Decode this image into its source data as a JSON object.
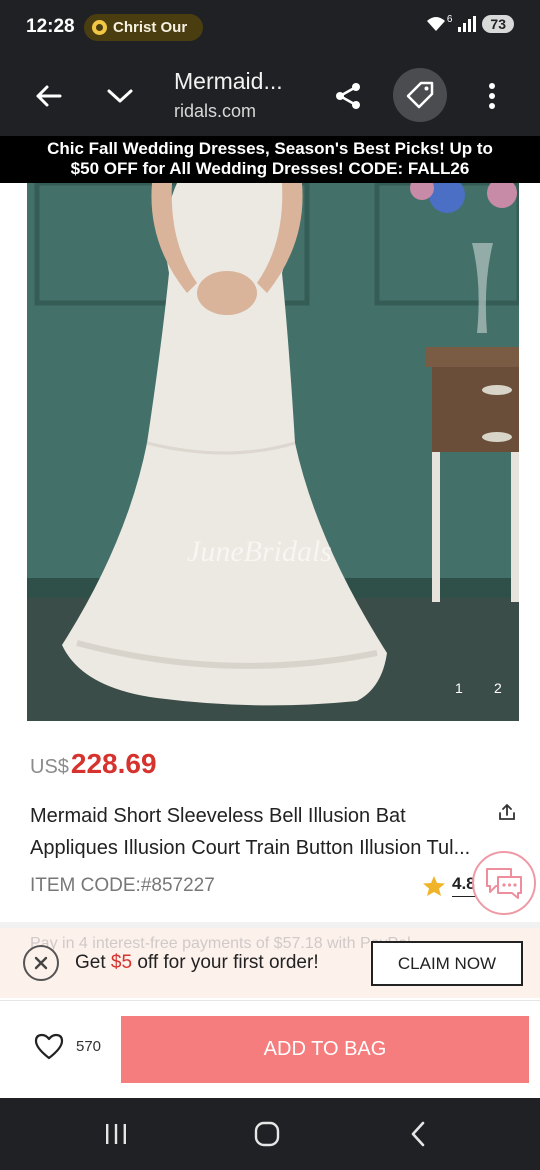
{
  "status_bar": {
    "time": "12:28",
    "notification": "Christ Our",
    "battery": "73",
    "signal_label": "6"
  },
  "browser": {
    "page_title": "Mermaid...",
    "url": "ridals.com"
  },
  "promo_banner": {
    "line1": "Chic Fall Wedding Dresses, Season's Best Picks! Up to",
    "line2": "$50 OFF for All Wedding Dresses! CODE: FALL26"
  },
  "gallery": {
    "watermark": "JuneBridals",
    "indices": [
      "1",
      "2"
    ]
  },
  "product": {
    "currency": "US$",
    "price": "228.69",
    "title_line1": "Mermaid Short Sleeveless Bell Illusion Bat",
    "title_line2": "Appliques Illusion Court Train Button Illusion Tul...",
    "item_code": "ITEM CODE:#857227",
    "rating": "4.8"
  },
  "coupon": {
    "pay_later": "Pay in 4 interest-free payments of $57.18 with PayPal",
    "text_before": "Get ",
    "amount": "$5",
    "text_after": " off for your first order!",
    "claim_label": "CLAIM NOW"
  },
  "actions": {
    "wishlist_count": "570",
    "add_to_bag": "ADD TO BAG"
  },
  "colors": {
    "price": "#d6332f",
    "add_to_bag_bg": "#f57d7d",
    "chrome_bg": "#1f2124",
    "promo_bg": "#000000"
  },
  "icons": {
    "back": "arrow-left-icon",
    "collapse": "chevron-down-icon",
    "share": "share-icon",
    "tag": "tag-icon",
    "menu": "more-vert-icon",
    "star": "star-icon",
    "chat": "chat-icon",
    "close": "close-icon",
    "heart": "heart-icon"
  }
}
